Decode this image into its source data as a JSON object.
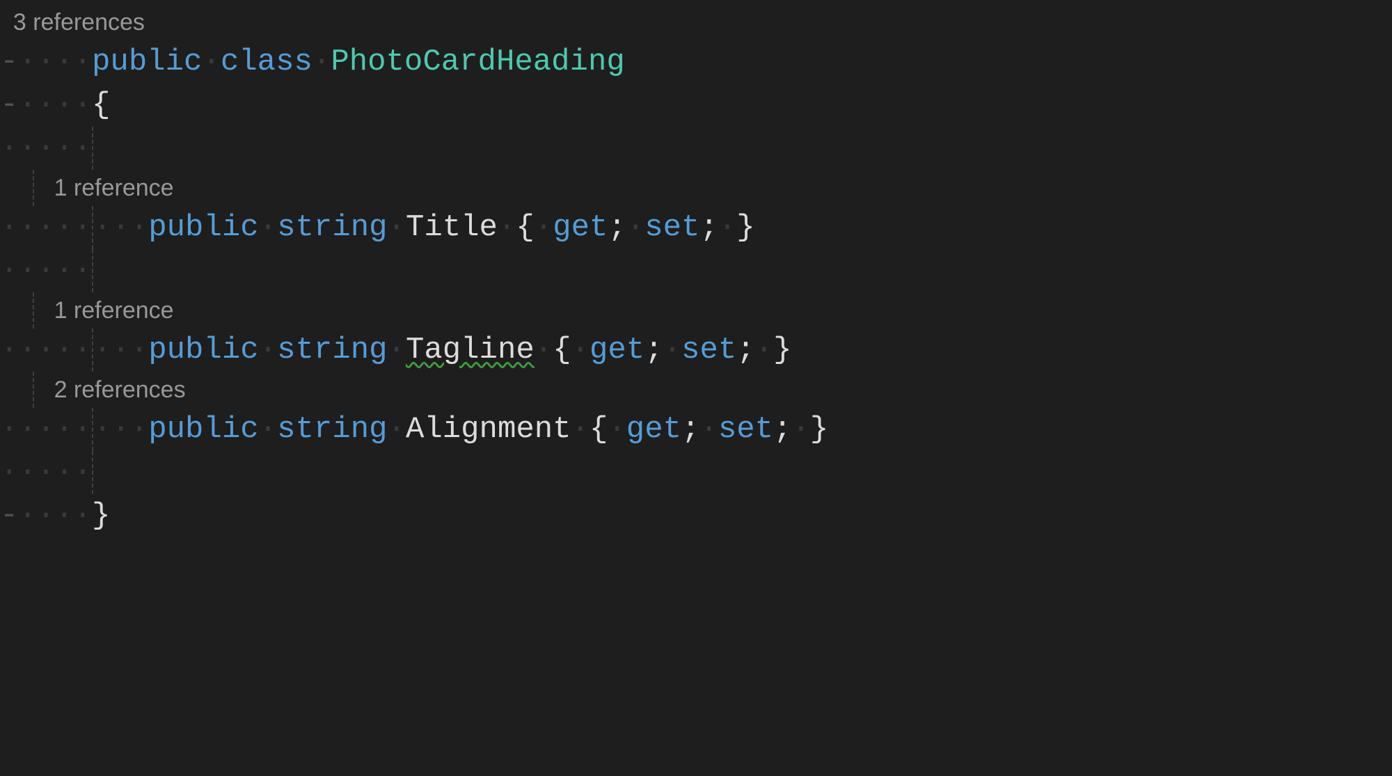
{
  "class": {
    "references": "3 references",
    "modifier": "public",
    "keyword": "class",
    "name": "PhotoCardHeading"
  },
  "brace_open": "{",
  "brace_close": "}",
  "properties": [
    {
      "references": "1 reference",
      "modifier": "public",
      "type": "string",
      "name": "Title",
      "accessor_open": "{",
      "get": "get",
      "set": "set",
      "semicolon": ";",
      "accessor_close": "}",
      "squiggle": false
    },
    {
      "references": "1 reference",
      "modifier": "public",
      "type": "string",
      "name": "Tagline",
      "accessor_open": "{",
      "get": "get",
      "set": "set",
      "semicolon": ";",
      "accessor_close": "}",
      "squiggle": true
    },
    {
      "references": "2 references",
      "modifier": "public",
      "type": "string",
      "name": "Alignment",
      "accessor_open": "{",
      "get": "get",
      "set": "set",
      "semicolon": ";",
      "accessor_close": "}",
      "squiggle": false
    }
  ],
  "dot4": "····",
  "dash": "-"
}
